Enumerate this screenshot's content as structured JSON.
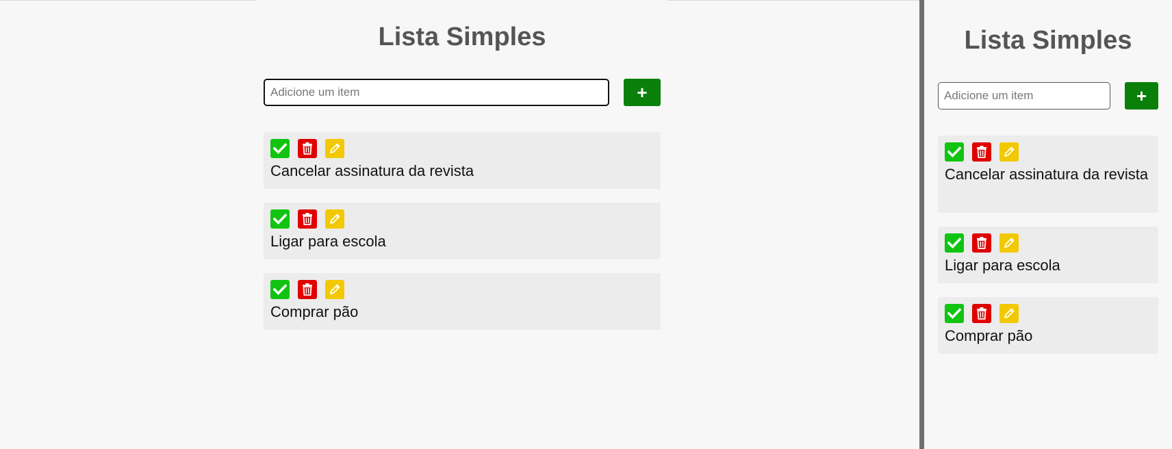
{
  "left_view": {
    "title": "Lista Simples",
    "input": {
      "placeholder": "Adicione um item",
      "value": ""
    },
    "add_button": {
      "label": "+"
    },
    "items": [
      {
        "text": "Cancelar assinatura da revista"
      },
      {
        "text": "Ligar para escola"
      },
      {
        "text": "Comprar pão"
      }
    ]
  },
  "right_view": {
    "title": "Lista Simples",
    "input": {
      "placeholder": "Adicione um item",
      "value": ""
    },
    "add_button": {
      "label": "+"
    },
    "items": [
      {
        "text": "Cancelar assinatura da revista"
      },
      {
        "text": "Ligar para escola"
      },
      {
        "text": "Comprar pão"
      }
    ]
  },
  "icons": {
    "complete": "check-icon",
    "delete": "trash-icon",
    "edit": "pencil-icon"
  },
  "colors": {
    "add_button": "#0a800a",
    "complete": "#11c411",
    "delete": "#e10000",
    "edit": "#f2c900",
    "title": "#555555"
  }
}
